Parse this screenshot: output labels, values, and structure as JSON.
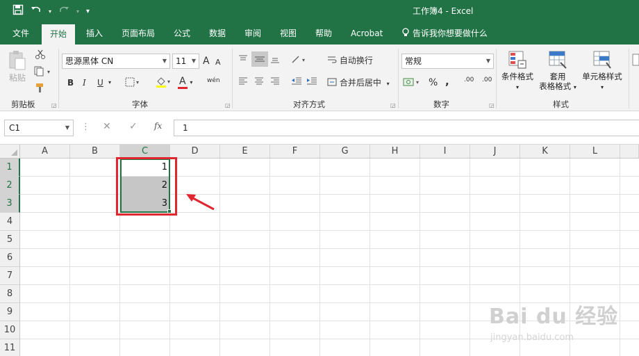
{
  "titlebar": {
    "title": "工作簿4  -  Excel",
    "qat": {
      "save_icon": "save-icon",
      "undo_icon": "undo-icon",
      "redo_icon": "redo-icon",
      "customize_icon": "chevron-down-icon"
    }
  },
  "tabs": [
    "文件",
    "开始",
    "插入",
    "页面布局",
    "公式",
    "数据",
    "审阅",
    "视图",
    "帮助",
    "Acrobat"
  ],
  "active_tab": "开始",
  "tell_me": "告诉我你想要做什么",
  "ribbon": {
    "clipboard": {
      "paste": "粘贴",
      "label": "剪贴板"
    },
    "font": {
      "family": "思源黑体 CN",
      "size": "11",
      "label": "字体",
      "bold": "B",
      "italic": "I",
      "underline": "U",
      "grow": "A",
      "shrink": "A",
      "font_color": "A",
      "phonetic": "wén"
    },
    "alignment": {
      "wrap": "自动换行",
      "merge": "合并后居中",
      "label": "对齐方式"
    },
    "number": {
      "format": "常规",
      "percent": "%",
      "comma": ",",
      "inc_dec": ".00",
      "dec_dec": ".00",
      "label": "数字"
    },
    "styles": {
      "conditional": "条件格式",
      "table1": "套用",
      "table2": "表格格式",
      "cell_styles": "单元格样式",
      "label": "样式"
    }
  },
  "formula_bar": {
    "name_box": "C1",
    "fx": "fx",
    "value": "1"
  },
  "grid": {
    "columns": [
      "A",
      "B",
      "C",
      "D",
      "E",
      "F",
      "G",
      "H",
      "I",
      "J",
      "K",
      "L"
    ],
    "selected_column": "C",
    "rows": [
      "1",
      "2",
      "3",
      "4",
      "5",
      "6",
      "7",
      "8",
      "9",
      "10",
      "11"
    ],
    "cells": {
      "C1": "1",
      "C2": "2",
      "C3": "3"
    }
  },
  "watermark": {
    "main": "Bai du 经验",
    "sub": "jingyan.baidu.com"
  },
  "colors": {
    "accent": "#217346",
    "highlight": "#e0262f"
  }
}
